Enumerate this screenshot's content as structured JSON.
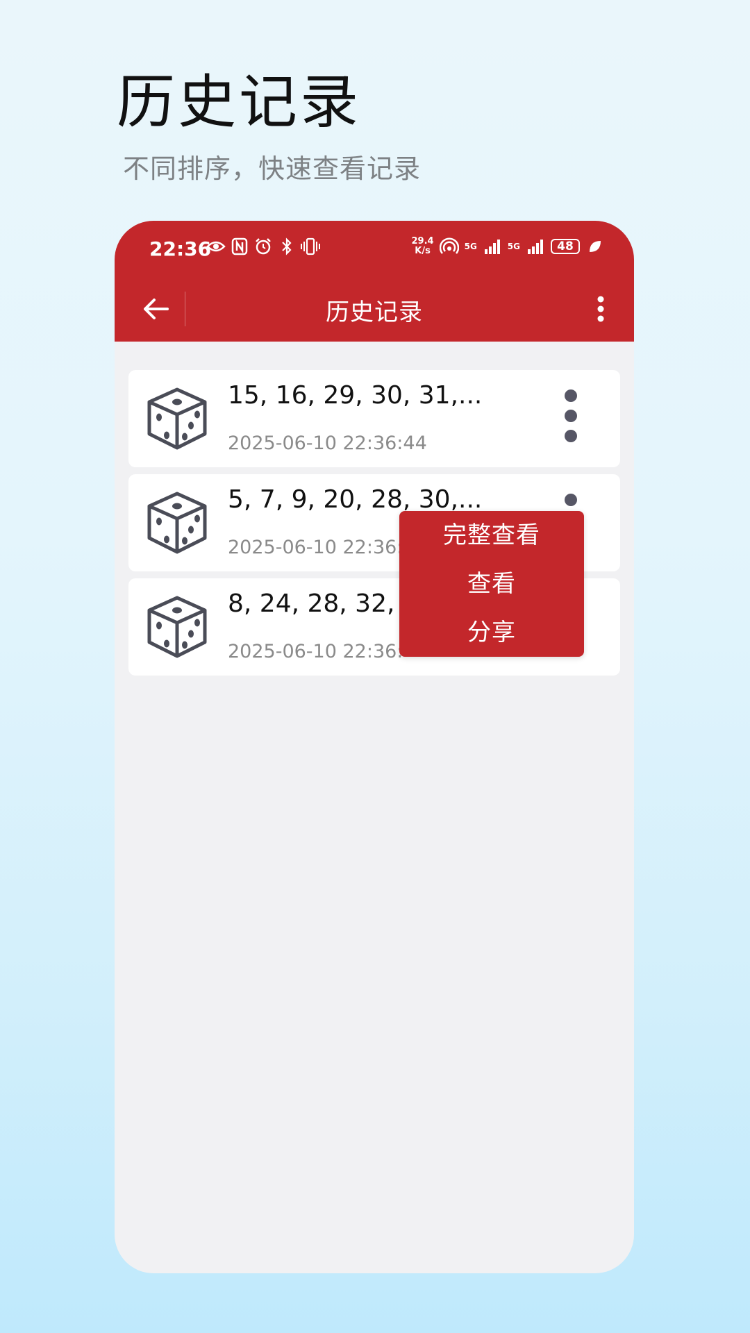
{
  "promo": {
    "title": "历史记录",
    "subtitle": "不同排序，快速查看记录"
  },
  "status_bar": {
    "time": "22:36",
    "net_speed_value": "29.4",
    "net_speed_unit": "K/s",
    "sim1": "5G",
    "sim2": "5G",
    "battery": "48",
    "icons": [
      "eye-icon",
      "nfc-icon",
      "alarm-icon",
      "bluetooth-icon",
      "vibrate-icon",
      "hotspot-icon",
      "signal-icon",
      "signal-icon",
      "leaf-icon"
    ]
  },
  "toolbar": {
    "title": "历史记录",
    "back_icon": "arrow-left-icon",
    "more_icon": "more-vert-icon"
  },
  "records": [
    {
      "numbers": "15, 16, 29, 30, 31,...",
      "time": "2025-06-10 22:36:44",
      "icon": "dice-icon"
    },
    {
      "numbers": "5, 7, 9, 20, 28, 30,...",
      "time": "2025-06-10 22:36:",
      "icon": "dice-icon"
    },
    {
      "numbers": "8, 24, 28, 32, 3",
      "time": "2025-06-10 22:36:",
      "icon": "dice-icon"
    }
  ],
  "popup_menu": {
    "items": [
      "完整查看",
      "查看",
      "分享"
    ]
  },
  "colors": {
    "primary": "#c3272b",
    "list_background": "#f1f1f3",
    "menu_dots": "#565665"
  }
}
